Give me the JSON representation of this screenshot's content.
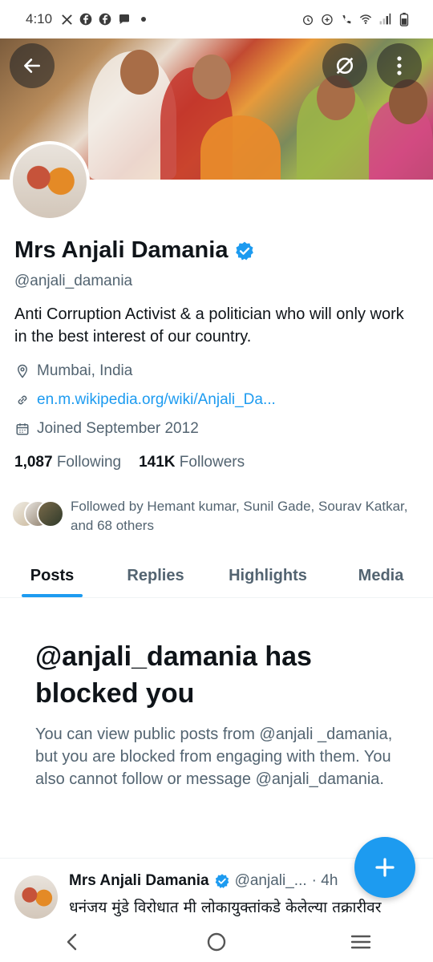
{
  "status_bar": {
    "time": "4:10",
    "left_icons": [
      "x-icon",
      "facebook-icon",
      "facebook-icon",
      "chat-icon",
      "dot-icon"
    ],
    "right_icons": [
      "alarm-icon",
      "data-saver-icon",
      "wifi-call-icon",
      "wifi-icon",
      "signal-icon",
      "battery-icon"
    ]
  },
  "profile": {
    "name": "Mrs Anjali Damania",
    "handle": "@anjali_damania",
    "bio": "Anti Corruption Activist & a politician who will only work in the best interest of our country.",
    "location": "Mumbai, India",
    "website": "en.m.wikipedia.org/wiki/Anjali_Da...",
    "joined": "Joined September 2012",
    "following_count": "1,087",
    "following_label": "Following",
    "followers_count": "141K",
    "followers_label": "Followers",
    "followed_by": "Followed by Hemant kumar, Sunil Gade, Sourav Katkar, and 68 others"
  },
  "tabs": [
    {
      "label": "Posts",
      "active": true
    },
    {
      "label": "Replies",
      "active": false
    },
    {
      "label": "Highlights",
      "active": false
    },
    {
      "label": "Media",
      "active": false
    }
  ],
  "blocked": {
    "title": "@anjali_damania has blocked you",
    "message": "You can view public posts from @anjali _damania, but you are blocked from engaging with them. You also cannot follow or message @anjali_damania."
  },
  "tweet": {
    "name": "Mrs Anjali Damania",
    "handle": "@anjali_...",
    "time": "· 4h",
    "text": "धनंजय मुंडे विरोधात मी लोकायुक्तांकडे केलेल्या तक्रारीवर"
  },
  "colors": {
    "accent": "#1d9bf0",
    "text_primary": "#0f1419",
    "text_secondary": "#536471"
  }
}
